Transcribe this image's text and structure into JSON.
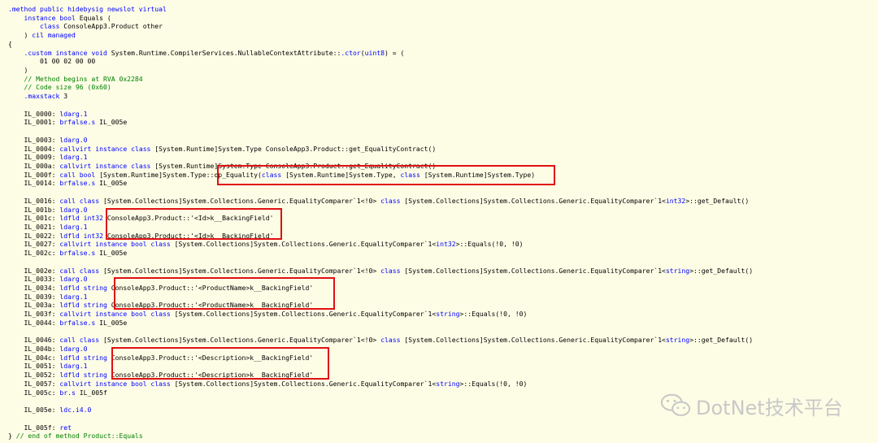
{
  "code_lines": [
    [
      [
        "kw",
        ".method public hidebysig newslot virtual"
      ]
    ],
    [
      [
        "t",
        "    "
      ],
      [
        "kw",
        "instance bool"
      ],
      [
        "t",
        " Equals ("
      ]
    ],
    [
      [
        "t",
        "        "
      ],
      [
        "kw",
        "class"
      ],
      [
        "t",
        " ConsoleApp3.Product other"
      ]
    ],
    [
      [
        "t",
        "    ) "
      ],
      [
        "kw",
        "cil managed"
      ]
    ],
    [
      [
        "t",
        "{"
      ]
    ],
    [
      [
        "t",
        "    "
      ],
      [
        "kw",
        ".custom instance void"
      ],
      [
        "t",
        " System.Runtime.CompilerServices.NullableContextAttribute::"
      ],
      [
        "kw",
        ".ctor"
      ],
      [
        "t",
        "("
      ],
      [
        "kw",
        "uint8"
      ],
      [
        "t",
        ") = ("
      ]
    ],
    [
      [
        "t",
        "        01 00 02 00 00"
      ]
    ],
    [
      [
        "t",
        "    )"
      ]
    ],
    [
      [
        "cm",
        "    // Method begins at RVA 0x2284"
      ]
    ],
    [
      [
        "cm",
        "    // Code size 96 (0x60)"
      ]
    ],
    [
      [
        "t",
        "    "
      ],
      [
        "kw",
        ".maxstack"
      ],
      [
        "t",
        " 3"
      ]
    ],
    [
      [
        "t",
        ""
      ]
    ],
    [
      [
        "t",
        "    IL_0000: "
      ],
      [
        "kw",
        "ldarg.1"
      ]
    ],
    [
      [
        "t",
        "    IL_0001: "
      ],
      [
        "kw",
        "brfalse.s"
      ],
      [
        "t",
        " IL_005e"
      ]
    ],
    [
      [
        "t",
        ""
      ]
    ],
    [
      [
        "t",
        "    IL_0003: "
      ],
      [
        "kw",
        "ldarg.0"
      ]
    ],
    [
      [
        "t",
        "    IL_0004: "
      ],
      [
        "kw",
        "callvirt instance class"
      ],
      [
        "t",
        " [System.Runtime]System.Type ConsoleApp3.Product::get_EqualityContract()"
      ]
    ],
    [
      [
        "t",
        "    IL_0009: "
      ],
      [
        "kw",
        "ldarg.1"
      ]
    ],
    [
      [
        "t",
        "    IL_000a: "
      ],
      [
        "kw",
        "callvirt instance class"
      ],
      [
        "t",
        " [System.Runtime]System.Type ConsoleApp3.Product::get_EqualityContract()"
      ]
    ],
    [
      [
        "t",
        "    IL_000f: "
      ],
      [
        "kw",
        "call bool"
      ],
      [
        "t",
        " [System.Runtime]System.Type::op_Equality("
      ],
      [
        "kw",
        "class"
      ],
      [
        "t",
        " [System.Runtime]System.Type, "
      ],
      [
        "kw",
        "class"
      ],
      [
        "t",
        " [System.Runtime]System.Type)"
      ]
    ],
    [
      [
        "t",
        "    IL_0014: "
      ],
      [
        "kw",
        "brfalse.s"
      ],
      [
        "t",
        " IL_005e"
      ]
    ],
    [
      [
        "t",
        ""
      ]
    ],
    [
      [
        "t",
        "    IL_0016: "
      ],
      [
        "kw",
        "call class"
      ],
      [
        "t",
        " [System.Collections]System.Collections.Generic.EqualityComparer`1<!0> "
      ],
      [
        "kw",
        "class"
      ],
      [
        "t",
        " [System.Collections]System.Collections.Generic.EqualityComparer`1<"
      ],
      [
        "kw",
        "int32"
      ],
      [
        "t",
        ">::get_Default()"
      ]
    ],
    [
      [
        "t",
        "    IL_001b: "
      ],
      [
        "kw",
        "ldarg.0"
      ]
    ],
    [
      [
        "t",
        "    IL_001c: "
      ],
      [
        "kw",
        "ldfld int32"
      ],
      [
        "t",
        " ConsoleApp3.Product::'<Id>k__BackingField'"
      ]
    ],
    [
      [
        "t",
        "    IL_0021: "
      ],
      [
        "kw",
        "ldarg.1"
      ]
    ],
    [
      [
        "t",
        "    IL_0022: "
      ],
      [
        "kw",
        "ldfld int32"
      ],
      [
        "t",
        " ConsoleApp3.Product::'<Id>k__BackingField'"
      ]
    ],
    [
      [
        "t",
        "    IL_0027: "
      ],
      [
        "kw",
        "callvirt instance bool class"
      ],
      [
        "t",
        " [System.Collections]System.Collections.Generic.EqualityComparer`1<"
      ],
      [
        "kw",
        "int32"
      ],
      [
        "t",
        ">::Equals(!0, !0)"
      ]
    ],
    [
      [
        "t",
        "    IL_002c: "
      ],
      [
        "kw",
        "brfalse.s"
      ],
      [
        "t",
        " IL_005e"
      ]
    ],
    [
      [
        "t",
        ""
      ]
    ],
    [
      [
        "t",
        "    IL_002e: "
      ],
      [
        "kw",
        "call class"
      ],
      [
        "t",
        " [System.Collections]System.Collections.Generic.EqualityComparer`1<!0> "
      ],
      [
        "kw",
        "class"
      ],
      [
        "t",
        " [System.Collections]System.Collections.Generic.EqualityComparer`1<"
      ],
      [
        "kw",
        "string"
      ],
      [
        "t",
        ">::get_Default()"
      ]
    ],
    [
      [
        "t",
        "    IL_0033: "
      ],
      [
        "kw",
        "ldarg.0"
      ]
    ],
    [
      [
        "t",
        "    IL_0034: "
      ],
      [
        "kw",
        "ldfld string"
      ],
      [
        "t",
        " ConsoleApp3.Product::'<ProductName>k__BackingField'"
      ]
    ],
    [
      [
        "t",
        "    IL_0039: "
      ],
      [
        "kw",
        "ldarg.1"
      ]
    ],
    [
      [
        "t",
        "    IL_003a: "
      ],
      [
        "kw",
        "ldfld string"
      ],
      [
        "t",
        " ConsoleApp3.Product::'<ProductName>k__BackingField'"
      ]
    ],
    [
      [
        "t",
        "    IL_003f: "
      ],
      [
        "kw",
        "callvirt instance bool class"
      ],
      [
        "t",
        " [System.Collections]System.Collections.Generic.EqualityComparer`1<"
      ],
      [
        "kw",
        "string"
      ],
      [
        "t",
        ">::Equals(!0, !0)"
      ]
    ],
    [
      [
        "t",
        "    IL_0044: "
      ],
      [
        "kw",
        "brfalse.s"
      ],
      [
        "t",
        " IL_005e"
      ]
    ],
    [
      [
        "t",
        ""
      ]
    ],
    [
      [
        "t",
        "    IL_0046: "
      ],
      [
        "kw",
        "call class"
      ],
      [
        "t",
        " [System.Collections]System.Collections.Generic.EqualityComparer`1<!0> "
      ],
      [
        "kw",
        "class"
      ],
      [
        "t",
        " [System.Collections]System.Collections.Generic.EqualityComparer`1<"
      ],
      [
        "kw",
        "string"
      ],
      [
        "t",
        ">::get_Default()"
      ]
    ],
    [
      [
        "t",
        "    IL_004b: "
      ],
      [
        "kw",
        "ldarg.0"
      ]
    ],
    [
      [
        "t",
        "    IL_004c: "
      ],
      [
        "kw",
        "ldfld string"
      ],
      [
        "t",
        " ConsoleApp3.Product::'<Description>k__BackingField'"
      ]
    ],
    [
      [
        "t",
        "    IL_0051: "
      ],
      [
        "kw",
        "ldarg.1"
      ]
    ],
    [
      [
        "t",
        "    IL_0052: "
      ],
      [
        "kw",
        "ldfld string"
      ],
      [
        "t",
        " ConsoleApp3.Product::'<Description>k__BackingField'"
      ]
    ],
    [
      [
        "t",
        "    IL_0057: "
      ],
      [
        "kw",
        "callvirt instance bool class"
      ],
      [
        "t",
        " [System.Collections]System.Collections.Generic.EqualityComparer`1<"
      ],
      [
        "kw",
        "string"
      ],
      [
        "t",
        ">::Equals(!0, !0)"
      ]
    ],
    [
      [
        "t",
        "    IL_005c: "
      ],
      [
        "kw",
        "br.s"
      ],
      [
        "t",
        " IL_005f"
      ]
    ],
    [
      [
        "t",
        ""
      ]
    ],
    [
      [
        "t",
        "    IL_005e: "
      ],
      [
        "kw",
        "ldc.i4.0"
      ]
    ],
    [
      [
        "t",
        ""
      ]
    ],
    [
      [
        "t",
        "    IL_005f: "
      ],
      [
        "kw",
        "ret"
      ]
    ],
    [
      [
        "t",
        "} "
      ],
      [
        "cm",
        "// end of method Product::Equals"
      ]
    ]
  ],
  "highlight_color": "#e01010",
  "watermark": {
    "icon": "wechat-icon",
    "text": "DotNet技术平台"
  }
}
